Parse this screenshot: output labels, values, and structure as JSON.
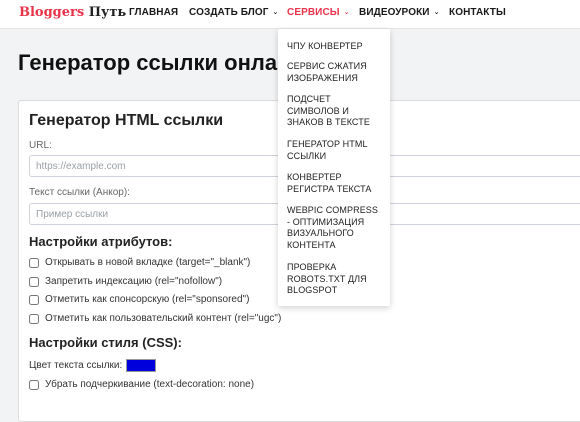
{
  "brand": {
    "part1": "Bloggers",
    "part2": "Путь"
  },
  "nav": {
    "items": [
      {
        "label": "ГЛАВНАЯ",
        "caret": ""
      },
      {
        "label": "СОЗДАТЬ БЛОГ",
        "caret": "⌄"
      },
      {
        "label": "СЕРВИСЫ",
        "caret": "⌄"
      },
      {
        "label": "ВИДЕОУРОКИ",
        "caret": "⌄"
      },
      {
        "label": "КОНТАКТЫ",
        "caret": ""
      }
    ],
    "active_index": 2
  },
  "dropdown": {
    "items": [
      "ЧПУ КОНВЕРТЕР",
      "СЕРВИС СЖАТИЯ ИЗОБРАЖЕНИЯ",
      "ПОДСЧЕТ СИМВОЛОВ И ЗНАКОВ В ТЕКСТЕ",
      "ГЕНЕРАТОР HTML ССЫЛКИ",
      "КОНВЕРТЕР РЕГИСТРА ТЕКСТА",
      "WEBPIC COMPRESS - ОПТИМИЗАЦИЯ ВИЗУАЛЬНОГО КОНТЕНТА",
      "ПРОВЕРКА ROBOTS.TXT ДЛЯ BLOGSPOT"
    ]
  },
  "page": {
    "title": "Генератор ссылки онлайн"
  },
  "form": {
    "title": "Генератор HTML ссылки",
    "url_label": "URL:",
    "url_placeholder": "https://example.com",
    "url_value": "",
    "anchor_label": "Текст ссылки (Анкор):",
    "anchor_placeholder": "Пример ссылки",
    "anchor_value": "",
    "attrs_title": "Настройки атрибутов:",
    "attrs": [
      {
        "label": "Открывать в новой вкладке (target=\"_blank\")",
        "checked": false
      },
      {
        "label": "Запретить индексацию (rel=\"nofollow\")",
        "checked": false
      },
      {
        "label": "Отметить как спонсорскую (rel=\"sponsored\")",
        "checked": false
      },
      {
        "label": "Отметить как пользовательский контент (rel=\"ugc\")",
        "checked": false
      }
    ],
    "style_title": "Настройки стиля (CSS):",
    "color_label": "Цвет текста ссылки:",
    "link_color": "#0000dd",
    "underline_label": "Убрать подчеркивание (text-decoration: none)",
    "underline_checked": false
  },
  "colors": {
    "accent": "#e8334a",
    "page_bg": "#f2f3f5"
  }
}
